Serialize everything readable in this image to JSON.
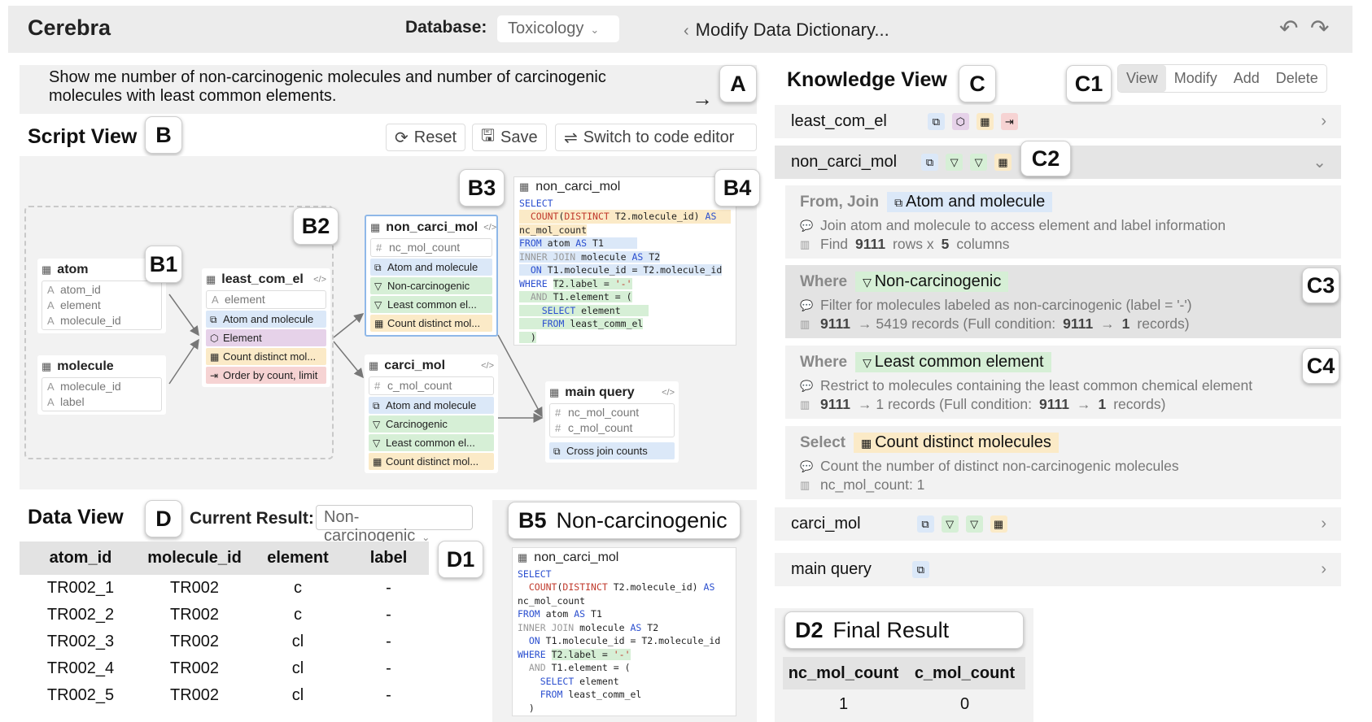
{
  "app": {
    "title": "Cerebra",
    "db_label": "Database:",
    "db_value": "Toxicology",
    "modify_dd": "Modify Data Dictionary..."
  },
  "query": {
    "text": "Show me number of non-carcinogenic molecules and number of carcinogenic molecules with least common elements."
  },
  "badges": {
    "A": "A",
    "B": "B",
    "B1": "B1",
    "B2": "B2",
    "B3": "B3",
    "B4": "B4",
    "B5": "B5",
    "C": "C",
    "C1": "C1",
    "C2": "C2",
    "C3": "C3",
    "C4": "C4",
    "D": "D",
    "D1": "D1",
    "D2": "D2"
  },
  "script_view": {
    "title": "Script View",
    "reset": "Reset",
    "save": "Save",
    "switch": "Switch to code editor",
    "atom": {
      "name": "atom",
      "fields": [
        "atom_id",
        "element",
        "molecule_id"
      ]
    },
    "molecule": {
      "name": "molecule",
      "fields": [
        "molecule_id",
        "label"
      ]
    },
    "least_com_el": {
      "name": "least_com_el",
      "field": "element",
      "steps": [
        "Atom and molecule",
        "Element",
        "Count distinct mol...",
        "Order by count, limit"
      ]
    },
    "non_carci_mol": {
      "name": "non_carci_mol",
      "field": "nc_mol_count",
      "steps": [
        "Atom and molecule",
        "Non-carcinogenic",
        "Least common el...",
        "Count distinct mol..."
      ]
    },
    "carci_mol": {
      "name": "carci_mol",
      "field": "c_mol_count",
      "steps": [
        "Atom and molecule",
        "Carcinogenic",
        "Least common el...",
        "Count distinct mol..."
      ]
    },
    "main_query": {
      "name": "main query",
      "fields": [
        "nc_mol_count",
        "c_mol_count"
      ],
      "step": "Cross join counts"
    },
    "sql_title": "non_carci_mol"
  },
  "b5_title": "Non-carcinogenic",
  "data_view": {
    "title": "Data View",
    "current_label": "Current Result:",
    "current_value": "Non-carcinogenic",
    "columns": [
      "atom_id",
      "molecule_id",
      "element",
      "label"
    ],
    "rows": [
      [
        "TR002_1",
        "TR002",
        "c",
        "-"
      ],
      [
        "TR002_2",
        "TR002",
        "c",
        "-"
      ],
      [
        "TR002_3",
        "TR002",
        "cl",
        "-"
      ],
      [
        "TR002_4",
        "TR002",
        "cl",
        "-"
      ],
      [
        "TR002_5",
        "TR002",
        "cl",
        "-"
      ]
    ]
  },
  "knowledge_view": {
    "title": "Knowledge View",
    "tabs": [
      "View",
      "Modify",
      "Add",
      "Delete"
    ],
    "rows": {
      "least_com_el": "least_com_el",
      "non_carci_mol": "non_carci_mol",
      "carci_mol": "carci_mol",
      "main_query": "main query"
    },
    "steps": [
      {
        "kind": "From, Join",
        "tag": "Atom and molecule",
        "desc": "Join atom and molecule to access element and label information",
        "stat_a": "Find",
        "stat_b": "9111",
        "stat_c": "rows x",
        "stat_d": "5",
        "stat_e": "columns"
      },
      {
        "kind": "Where",
        "tag": "Non-carcinogenic",
        "desc": "Filter for molecules labeled as non-carcinogenic (label = '-')",
        "s1": "9111",
        "s2": "→ 5419 records (Full condition:",
        "s3": "9111",
        "s4": "→",
        "s5": "1",
        "s6": "records)"
      },
      {
        "kind": "Where",
        "tag": "Least common element",
        "desc": "Restrict to molecules containing the least common chemical element",
        "s1": "9111",
        "s2": "→ 1 records (Full condition:",
        "s3": "9111",
        "s4": "→",
        "s5": "1",
        "s6": "records)"
      },
      {
        "kind": "Select",
        "tag": "Count distinct molecules",
        "desc": "Count the number of distinct non-carcinogenic molecules",
        "stat": "nc_mol_count: 1"
      }
    ]
  },
  "final_result": {
    "title": "Final Result",
    "columns": [
      "nc_mol_count",
      "c_mol_count"
    ],
    "row": [
      "1",
      "0"
    ]
  },
  "colors": {
    "blue": "#dbe8f8",
    "green": "#d6efd6",
    "yellow": "#fbeac7",
    "purple": "#e6d2e9",
    "red": "#f6d3d3"
  }
}
